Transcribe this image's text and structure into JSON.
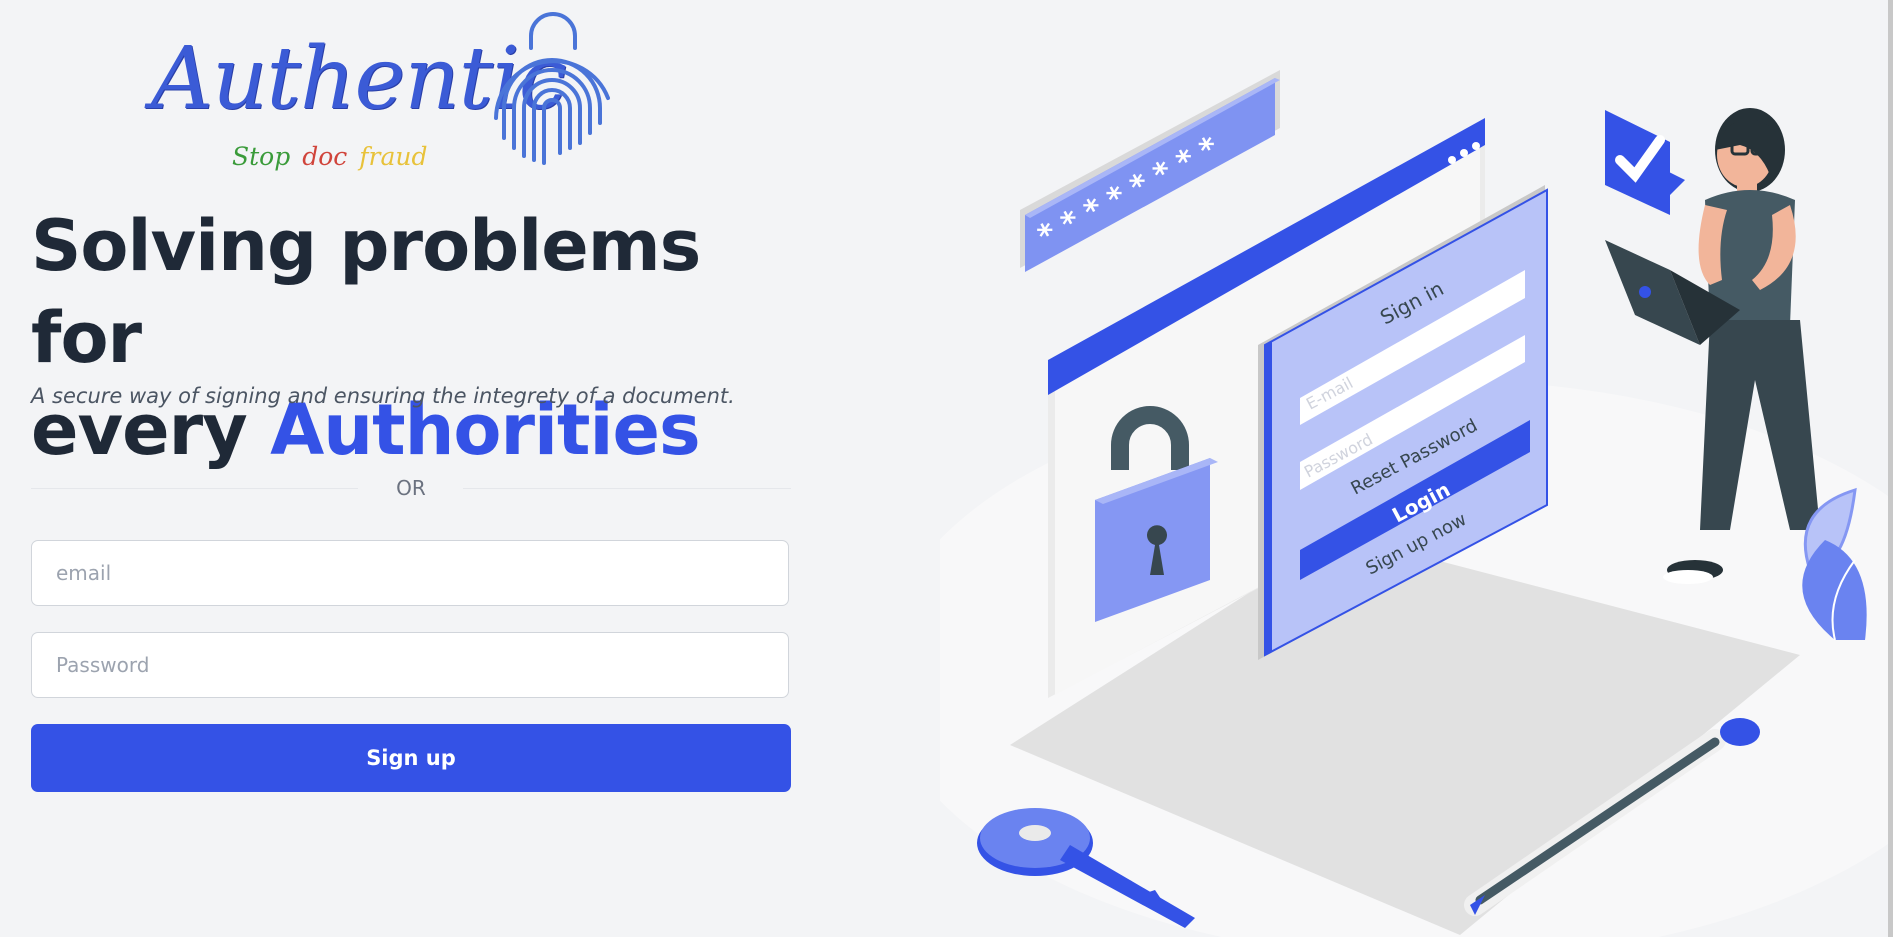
{
  "logo": {
    "word": "Authentic",
    "tagline": [
      "Stop",
      "doc",
      "fraud"
    ]
  },
  "hero": {
    "line1": "Solving problems for",
    "line2_prefix": "every",
    "line2_accent": "Authorities",
    "subtitle": "A secure way of signing and ensuring the integrety of a document."
  },
  "divider_label": "OR",
  "form": {
    "email_placeholder": "email",
    "password_placeholder": "Password",
    "submit_label": "Sign up"
  },
  "illustration": {
    "password_mask": "* * * * * * * *",
    "signin_title": "Sign in",
    "email_field": "E-mail",
    "password_field": "Password",
    "reset_link": "Reset Password",
    "login_button": "Login",
    "signup_link": "Sign up now"
  },
  "colors": {
    "accent": "#3452e6",
    "text": "#1f2937",
    "muted": "#4b5563"
  }
}
